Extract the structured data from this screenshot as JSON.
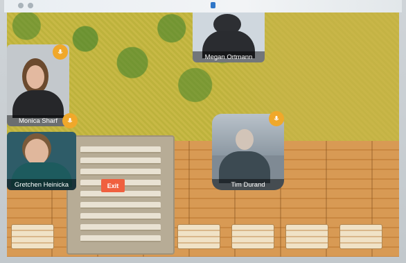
{
  "participants": [
    {
      "name": "Megan Ortmann"
    },
    {
      "name": "Monica Sharf"
    },
    {
      "name": "Gretchen Heinicka"
    },
    {
      "name": "Tim Durand"
    }
  ],
  "controls": {
    "exit_label": "Exit"
  },
  "colors": {
    "mic": "#f0a82a",
    "exit": "#f0603f"
  },
  "icons": {
    "mic": "microphone-icon"
  }
}
